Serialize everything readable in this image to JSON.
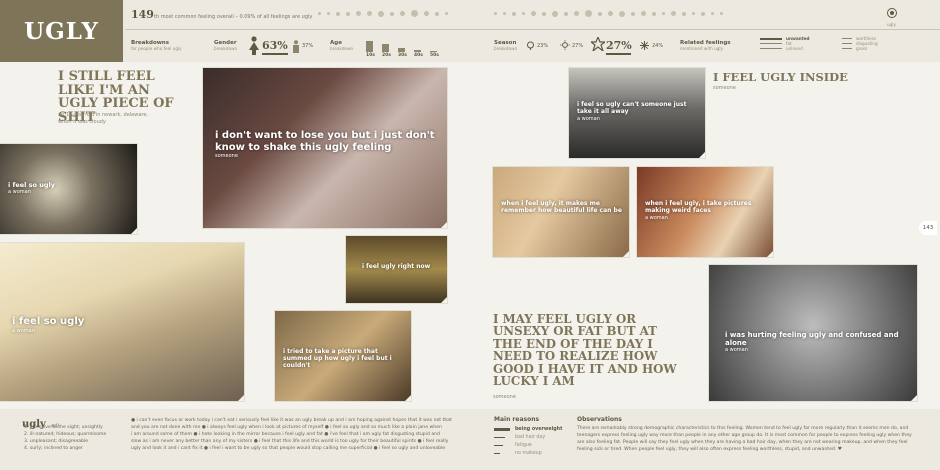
{
  "header": {
    "feeling": "UGLY",
    "rank_number": "149",
    "rank_suffix": "th",
    "rank_text": "most common feeling overall",
    "rank_pct": "– 0.09% of all feelings are ugly",
    "breakdowns_title": "Breakdowns",
    "breakdowns_sub": "for people who feel ugly",
    "gender_title": "Gender",
    "gender_sub": "breakdown",
    "female_pct": "63%",
    "male_pct": "37%",
    "age_title": "Age",
    "age_sub": "breakdown",
    "age_labels": [
      "10s",
      "20s",
      "30s",
      "40s",
      "50s"
    ],
    "age_values": [
      0.8,
      0.55,
      0.3,
      0.15,
      0.1
    ],
    "season_title": "Season",
    "season_sub": "breakdown",
    "season_pcts": [
      "23%",
      "27%",
      "27%",
      "24%"
    ],
    "season_icons": [
      "spring-icon",
      "summer-icon",
      "autumn-icon",
      "winter-icon"
    ],
    "related_title": "Related feelings",
    "related_sub": "mentioned with ugly",
    "related_col1": [
      "unwanted",
      "fat",
      "unloved"
    ],
    "related_col2": [
      "worthless",
      "disgusting",
      "gross"
    ],
    "timeline_label": "ugly"
  },
  "left": {
    "headline": "I STILL FEEL LIKE I'M AN UGLY PIECE OF SHIT",
    "headline_attrib": "an 18-year-old in newark, delaware, when it was cloudy",
    "photo_big_caption": "i don't want to lose you but i just don't know to shake this ugly feeling",
    "photo_big_attrib": "someone",
    "photo_small_caption": "i feel so ugly",
    "photo_small_attrib": "a woman",
    "photo_face_caption": "i feel so ugly",
    "photo_face_attrib": "a woman",
    "photo_guy_caption": "i feel ugly right now",
    "photo_cam_caption": "i tried to take a picture that summed up how ugly i feel but i couldn't"
  },
  "right": {
    "headline1": "I FEEL UGLY INSIDE",
    "headline1_attrib": "someone",
    "photo_top_caption": "i feel so ugly can't someone just take it all away",
    "photo_top_attrib": "a woman",
    "photo_mid1_caption": "when i feel ugly, it makes me remember how beautiful life can be",
    "photo_mid2_caption": "when i feel ugly, i take pictures making weird faces",
    "photo_mid2_attrib": "a woman",
    "headline2": "I MAY FEEL UGLY OR UNSEXY OR FAT BUT AT THE END OF THE DAY I NEED TO REALIZE HOW GOOD I HAVE IT AND HOW LUCKY I AM",
    "headline2_attrib": "someone",
    "photo_eye_caption": "i was hurting feeling ugly and confused and alone",
    "photo_eye_attrib": "a woman"
  },
  "footer": {
    "word": "ugly",
    "pos": "adj.",
    "defs": [
      "1. offensive to the sight; unsightly",
      "2. ill-natured; hideous; quarrelsome",
      "3. unpleasant; disagreeable",
      "4. surly; inclined to anger"
    ],
    "quotes": [
      "● i can't even focus or work today i can't eat i seriously feel like it was an ugly break up and i am hoping against hopes that it was not that",
      "and you are not done with me ● i always feel ugly when i look at pictures of myself ● i feel so ugly and so much like a plain jane when",
      "i am around some of them ● i hate looking in the mirror because i feel ugly and fat ● i've feel that i am ugly fat disgusting stupid and",
      "slow as i am never any better than any of my sisters ● i feel that this life and this world is too ugly for their beautiful spirits ● i feel really",
      "ugly and look it and i cant fix it ● i feel i want to be ugly so that people would stop calling me superficial ● i feel so ugly and unloveable"
    ],
    "reasons_title": "Main reasons",
    "reasons": [
      "being overweight",
      "bad hair day",
      "fatigue",
      "no makeup"
    ],
    "reason_weights": [
      1,
      0.7,
      0.55,
      0.4
    ],
    "obs_title": "Observations",
    "obs_lines": [
      "There are remarkably strong demographic characteristics to this feeling. Women tend to feel ugly far more regularly than it seems men do, and",
      "teenagers express feeling ugly way more than people in any other age group do. It is most common for people to express feeling ugly when they",
      "are also feeling fat. People will say they feel ugly when they are having a bad hair day, when they are not wearing makeup, and when they feel",
      "feeling sick or tired. When people feel ugly, they will also often express feeling worthless, stupid, and unwanted. ♥"
    ]
  },
  "page_number": "143"
}
